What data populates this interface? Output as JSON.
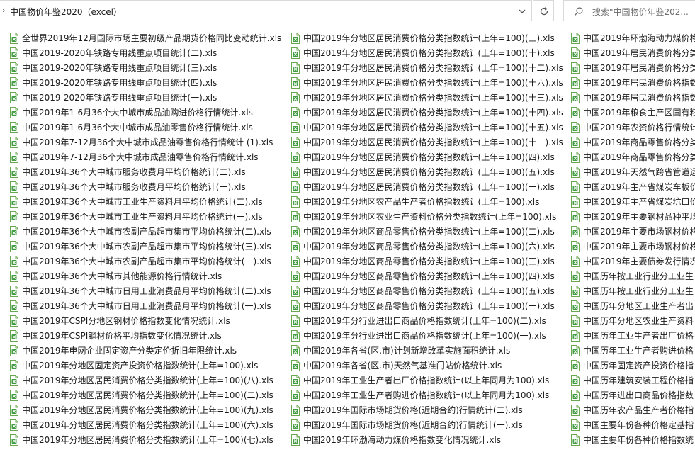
{
  "address_bar": {
    "back_glyph": "›",
    "path": "中国物价年鉴2020（excel）"
  },
  "search": {
    "placeholder": "搜索\"中国物价年鉴202..."
  },
  "icons": {
    "file_icon": "excel-file-icon",
    "accent": "#3f9b3f"
  },
  "files": {
    "col1": [
      "全世界2019年12月国际市场主要初级产品期货价格同比变动统计.xls",
      "中国2019-2020年铁路专用线重点项目统计(二).xls",
      "中国2019-2020年铁路专用线重点项目统计(三).xls",
      "中国2019-2020年铁路专用线重点项目统计(四).xls",
      "中国2019-2020年铁路专用线重点项目统计(一).xls",
      "中国2019年1-6月36个大中城市成品油购进价格行情统计.xls",
      "中国2019年1-6月36个大中城市成品油零售价格行情统计.xls",
      "中国2019年7-12月36个大中城市成品油零售价格行情统计 (1).xls",
      "中国2019年7-12月36个大中城市成品油零售价格行情统计.xls",
      "中国2019年36个大中城市服务收费月平均价格统计(二).xls",
      "中国2019年36个大中城市服务收费月平均价格统计(一).xls",
      "中国2019年36个大中城市工业生产资料月平均价格统计(二).xls",
      "中国2019年36个大中城市工业生产资料月平均价格统计(一).xls",
      "中国2019年36个大中城市农副产品超市集市平均价格统计(二).xls",
      "中国2019年36个大中城市农副产品超市集市平均价格统计(三).xls",
      "中国2019年36个大中城市农副产品超市集市平均价格统计(一).xls",
      "中国2019年36个大中城市其他能源价格行情统计.xls",
      "中国2019年36个大中城市日用工业消费品月平均价格统计(二).xls",
      "中国2019年36个大中城市日用工业消费品月平均价格统计(一).xls",
      "中国2019年CSPI分地区钢材价格指数变化情况统计.xls",
      "中国2019年CSPI钢材价格平均指数变化情况统计.xls",
      "中国2019年电网企业固定资产分类定价折旧年限统计.xls",
      "中国2019年分地区固定资产投资价格指数统计(上年=100).xls",
      "中国2019年分地区居民消费价格分类指数统计(上年=100)(八).xls",
      "中国2019年分地区居民消费价格分类指数统计(上年=100)(二).xls",
      "中国2019年分地区居民消费价格分类指数统计(上年=100)(九).xls",
      "中国2019年分地区居民消费价格分类指数统计(上年=100)(六).xls",
      "中国2019年分地区居民消费价格分类指数统计(上年=100)(七).xls"
    ],
    "col2": [
      "中国2019年分地区居民消费价格分类指数统计(上年=100)(三).xls",
      "中国2019年分地区居民消费价格分类指数统计(上年=100)(十).xls",
      "中国2019年分地区居民消费价格分类指数统计(上年=100)(十二).xls",
      "中国2019年分地区居民消费价格分类指数统计(上年=100)(十六).xls",
      "中国2019年分地区居民消费价格分类指数统计(上年=100)(十三).xls",
      "中国2019年分地区居民消费价格分类指数统计(上年=100)(十四).xls",
      "中国2019年分地区居民消费价格分类指数统计(上年=100)(十五).xls",
      "中国2019年分地区居民消费价格分类指数统计(上年=100)(十一).xls",
      "中国2019年分地区居民消费价格分类指数统计(上年=100)(四).xls",
      "中国2019年分地区居民消费价格分类指数统计(上年=100)(五).xls",
      "中国2019年分地区居民消费价格分类指数统计(上年=100)(一).xls",
      "中国2019年分地区农产品生产者价格指数统计(上年=100).xls",
      "中国2019年分地区农业生产资料价格分类指数统计(上年=100).xls",
      "中国2019年分地区商品零售价格分类指数统计(上年=100)(二).xls",
      "中国2019年分地区商品零售价格分类指数统计(上年=100)(六).xls",
      "中国2019年分地区商品零售价格分类指数统计(上年=100)(三).xls",
      "中国2019年分地区商品零售价格分类指数统计(上年=100)(四).xls",
      "中国2019年分地区商品零售价格分类指数统计(上年=100)(五).xls",
      "中国2019年分地区商品零售价格分类指数统计(上年=100)(一).xls",
      "中国2019年分行业进出口商品价格指数统计(上年=100)(二).xls",
      "中国2019年分行业进出口商品价格指数统计(上年=100)(一).xls",
      "中国2019年各省(区.市)计划新增改革实施面积统计.xls",
      "中国2019年各省(区.市)天然气基准门站价格统计.xls",
      "中国2019年工业生产者出厂价格指数统计(以上年同月为100).xls",
      "中国2019年工业生产者购进价格指数统计(以上年同月为100).xls",
      "中国2019年国际市场期货价格(近期合约)行情统计(二).xls",
      "中国2019年国际市场期货价格(近期合约)行情统计(一).xls",
      "中国2019年环渤海动力煤价格指数变化情况统计.xls"
    ],
    "col3": [
      "中国2019年环渤海动力煤价格",
      "中国2019年居民消费价格分类",
      "中国2019年居民消费价格分类",
      "中国2019年居民消费价格指数",
      "中国2019年居民消费价格指数",
      "中国2019年粮食主产区国有粮",
      "中国2019年农资价格行情统计",
      "中国2019年商品零售价格分类",
      "中国2019年商品零售价格分类",
      "中国2019年天然气跨省管道运",
      "中国2019年主产省煤炭车板价",
      "中国2019年主产省煤炭坑口价",
      "中国2019年主要钢材品种平均",
      "中国2019年主要市场钢材价格",
      "中国2019年主要市场钢材价格",
      "中国2019年主要债券发行情况",
      "中国历年按工业行业分工业生",
      "中国历年按工业行业分工业生",
      "中国历年分地区工业生产者出",
      "中国历年分地区农业生产资料",
      "中国历年工业生产者出厂价格",
      "中国历年工业生产者购进价格",
      "中国历年固定资产投资价格指",
      "中国历年建筑安装工程价格指",
      "中国历年进出口商品价格指数",
      "中国历年农产品生产者价格指",
      "中国主要年份各种价格定基指",
      "中国主要年份各种价格指数统"
    ]
  }
}
